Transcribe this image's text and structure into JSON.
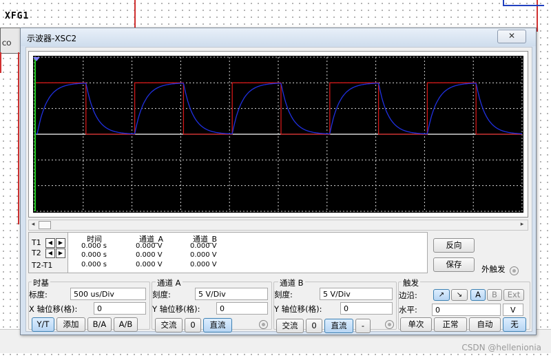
{
  "schematic": {
    "xfg_label": "XFG1",
    "xfg_text": "CO"
  },
  "window": {
    "title": "示波器-XSC2",
    "close_glyph": "✕"
  },
  "cursor_table": {
    "t1_label": "T1",
    "t2_label": "T2",
    "t2t1_label": "T2-T1",
    "headers": [
      "时间",
      "通道_A",
      "通道_B"
    ],
    "rows": [
      [
        "0.000 s",
        "0.000 V",
        "0.000 V"
      ],
      [
        "0.000 s",
        "0.000 V",
        "0.000 V"
      ],
      [
        "0.000 s",
        "0.000 V",
        "0.000 V"
      ]
    ]
  },
  "side_buttons": {
    "reverse": "反向",
    "save": "保存",
    "ext_trigger": "外触发"
  },
  "timebase": {
    "title": "时基",
    "scale_label": "标度:",
    "scale_value": "500 us/Div",
    "xpos_label": "X 轴位移(格):",
    "xpos_value": "0",
    "buttons": [
      "Y/T",
      "添加",
      "B/A",
      "A/B"
    ]
  },
  "channel_a": {
    "title": "通道 A",
    "scale_label": "刻度:",
    "scale_value": "5  V/Div",
    "ypos_label": "Y 轴位移(格):",
    "ypos_value": "0",
    "buttons": [
      "交流",
      "0",
      "直流"
    ]
  },
  "channel_b": {
    "title": "通道 B",
    "scale_label": "刻度:",
    "scale_value": "5  V/Div",
    "ypos_label": "Y 轴位移(格):",
    "ypos_value": "0",
    "buttons": [
      "交流",
      "0",
      "直流",
      "-"
    ]
  },
  "trigger": {
    "title": "触发",
    "edge_label": "边沿:",
    "level_label": "水平:",
    "level_value": "0",
    "level_unit": "V",
    "edge_buttons": [
      "↗",
      "↘"
    ],
    "source_buttons": [
      "A",
      "B",
      "Ext"
    ],
    "mode_buttons": [
      "单次",
      "正常",
      "自动",
      "无"
    ]
  },
  "watermark": "CSDN @hellenionia",
  "colors": {
    "channel_a": "#d01818",
    "channel_b": "#2030e0",
    "screen_bg": "#000000",
    "cursor": "#22cc22"
  },
  "chart_data": {
    "type": "line",
    "x_divisions": 10,
    "y_divisions": 6,
    "time_per_div_us": 500,
    "volts_per_div": 5,
    "period_divs": 2,
    "duty": 0.5,
    "series": [
      {
        "channel": "A",
        "color": "#d01818",
        "shape": "square",
        "high_divs": 2,
        "low_divs": 0
      },
      {
        "channel": "B",
        "color": "#2030e0",
        "shape": "rc_response",
        "high_divs": 2,
        "low_divs": 0
      }
    ]
  }
}
